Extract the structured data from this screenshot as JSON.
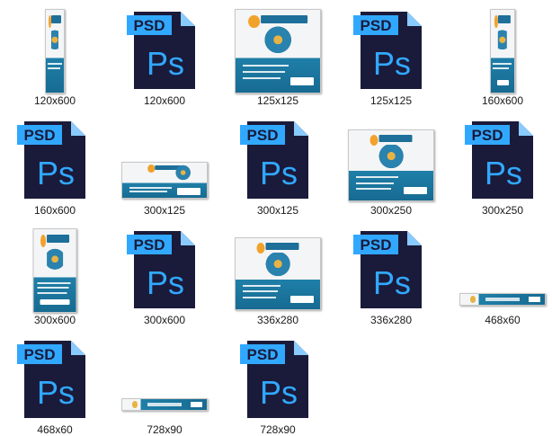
{
  "window": {
    "view": "large-icons"
  },
  "icon_names": {
    "psd": "photoshop-psd-file-icon",
    "banner": "banner-image-thumbnail"
  },
  "colors": {
    "psd_body": "#1a1a3a",
    "psd_banner": "#31a8ff",
    "psd_fold": "#89cbff",
    "banner_blue": "#1f7fa8",
    "banner_gold": "#e8b344"
  },
  "files": [
    {
      "name": "120x600",
      "kind": "image"
    },
    {
      "name": "120x600",
      "kind": "psd"
    },
    {
      "name": "125x125",
      "kind": "image"
    },
    {
      "name": "125x125",
      "kind": "psd"
    },
    {
      "name": "160x600",
      "kind": "image"
    },
    {
      "name": "160x600",
      "kind": "psd"
    },
    {
      "name": "300x125",
      "kind": "image"
    },
    {
      "name": "300x125",
      "kind": "psd"
    },
    {
      "name": "300x250",
      "kind": "image"
    },
    {
      "name": "300x250",
      "kind": "psd"
    },
    {
      "name": "300x600",
      "kind": "image"
    },
    {
      "name": "300x600",
      "kind": "psd"
    },
    {
      "name": "336x280",
      "kind": "image"
    },
    {
      "name": "336x280",
      "kind": "psd"
    },
    {
      "name": "468x60",
      "kind": "image"
    },
    {
      "name": "468x60",
      "kind": "psd"
    },
    {
      "name": "728x90",
      "kind": "image"
    },
    {
      "name": "728x90",
      "kind": "psd"
    }
  ],
  "psd_label": "PSD",
  "ps_label": "Ps"
}
